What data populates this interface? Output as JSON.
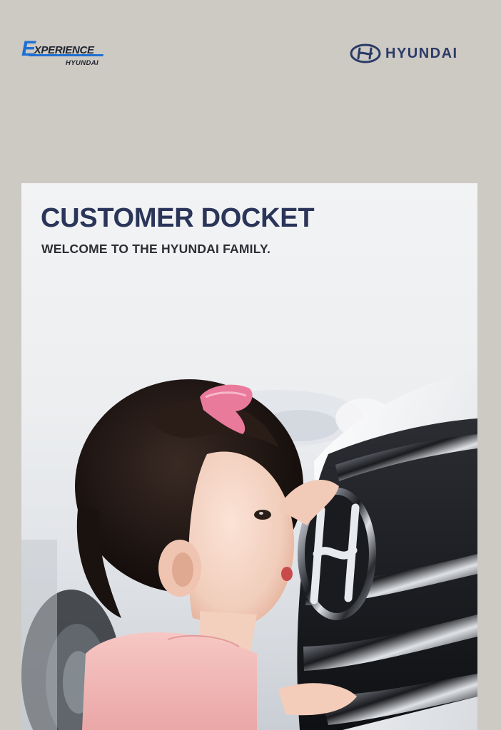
{
  "brand": {
    "experience_logo": {
      "initial": "E",
      "word": "XPERIENCE",
      "sub": "HYUNDAI"
    },
    "hyundai_logo": {
      "emblem_icon": "hyundai-emblem-icon",
      "word": "HYUNDAI"
    },
    "colors": {
      "background": "#cdc9c3",
      "navy": "#2a3559",
      "brand_blue": "#2b3a67",
      "accent_blue": "#1d6fd4"
    }
  },
  "cover": {
    "title": "CUSTOMER DOCKET",
    "subtitle": "WELCOME TO THE HYUNDAI FAMILY."
  }
}
